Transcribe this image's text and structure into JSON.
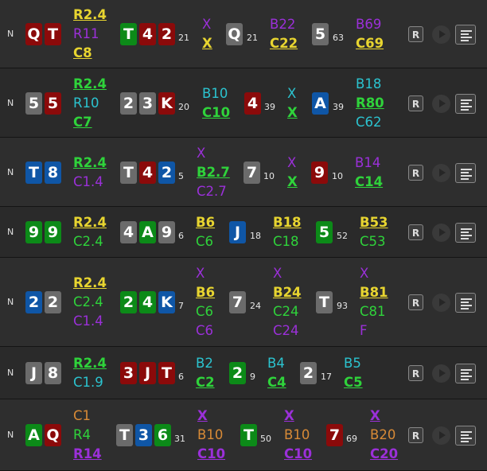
{
  "rows": [
    {
      "position": "N",
      "hand": [
        {
          "rank": "Q",
          "color": "red"
        },
        {
          "rank": "T",
          "color": "red"
        }
      ],
      "preflop_actions": [
        {
          "text": "R2.4",
          "color": "yellow",
          "strong": true
        },
        {
          "text": "R11",
          "color": "purple",
          "strong": false
        },
        {
          "text": "C8",
          "color": "yellow",
          "strong": true
        }
      ],
      "flop": {
        "cards": [
          {
            "rank": "T",
            "color": "green"
          },
          {
            "rank": "4",
            "color": "red"
          },
          {
            "rank": "2",
            "color": "red"
          }
        ],
        "pot": "21"
      },
      "flop_actions": [
        {
          "text": "X",
          "color": "purple",
          "strong": false
        },
        {
          "text": "X",
          "color": "yellow",
          "strong": true
        }
      ],
      "turn": {
        "card": {
          "rank": "Q",
          "color": "grey"
        },
        "pot": "21"
      },
      "turn_actions": [
        {
          "text": "B22",
          "color": "purple",
          "strong": false
        },
        {
          "text": "C22",
          "color": "yellow",
          "strong": true
        }
      ],
      "river": {
        "card": {
          "rank": "5",
          "color": "grey"
        },
        "pot": "63"
      },
      "river_actions": [
        {
          "text": "B69",
          "color": "purple",
          "strong": false
        },
        {
          "text": "C69",
          "color": "yellow",
          "strong": true
        }
      ],
      "replay_label": "R"
    },
    {
      "position": "N",
      "hand": [
        {
          "rank": "5",
          "color": "grey"
        },
        {
          "rank": "5",
          "color": "red"
        }
      ],
      "preflop_actions": [
        {
          "text": "R2.4",
          "color": "green",
          "strong": true
        },
        {
          "text": "R10",
          "color": "cyan",
          "strong": false
        },
        {
          "text": "C7",
          "color": "green",
          "strong": true
        }
      ],
      "flop": {
        "cards": [
          {
            "rank": "2",
            "color": "grey"
          },
          {
            "rank": "3",
            "color": "grey"
          },
          {
            "rank": "K",
            "color": "red"
          }
        ],
        "pot": "20"
      },
      "flop_actions": [
        {
          "text": "B10",
          "color": "cyan",
          "strong": false
        },
        {
          "text": "C10",
          "color": "green",
          "strong": true
        }
      ],
      "turn": {
        "card": {
          "rank": "4",
          "color": "red"
        },
        "pot": "39"
      },
      "turn_actions": [
        {
          "text": "X",
          "color": "cyan",
          "strong": false
        },
        {
          "text": "X",
          "color": "green",
          "strong": true
        }
      ],
      "river": {
        "card": {
          "rank": "A",
          "color": "blue"
        },
        "pot": "39"
      },
      "river_actions": [
        {
          "text": "B18",
          "color": "cyan",
          "strong": false
        },
        {
          "text": "R80",
          "color": "green",
          "strong": true
        },
        {
          "text": "C62",
          "color": "cyan",
          "strong": false
        }
      ],
      "replay_label": "R"
    },
    {
      "position": "N",
      "hand": [
        {
          "rank": "T",
          "color": "blue"
        },
        {
          "rank": "8",
          "color": "blue"
        }
      ],
      "preflop_actions": [
        {
          "text": "R2.4",
          "color": "green",
          "strong": true
        },
        {
          "text": "C1.4",
          "color": "purple",
          "strong": false
        }
      ],
      "flop": {
        "cards": [
          {
            "rank": "T",
            "color": "grey"
          },
          {
            "rank": "4",
            "color": "red"
          },
          {
            "rank": "2",
            "color": "blue"
          }
        ],
        "pot": "5"
      },
      "flop_actions": [
        {
          "text": "X",
          "color": "purple",
          "strong": false
        },
        {
          "text": "B2.7",
          "color": "green",
          "strong": true
        },
        {
          "text": "C2.7",
          "color": "purple",
          "strong": false
        }
      ],
      "turn": {
        "card": {
          "rank": "7",
          "color": "grey"
        },
        "pot": "10"
      },
      "turn_actions": [
        {
          "text": "X",
          "color": "purple",
          "strong": false
        },
        {
          "text": "X",
          "color": "green",
          "strong": true
        }
      ],
      "river": {
        "card": {
          "rank": "9",
          "color": "red"
        },
        "pot": "10"
      },
      "river_actions": [
        {
          "text": "B14",
          "color": "purple",
          "strong": false
        },
        {
          "text": "C14",
          "color": "green",
          "strong": true
        }
      ],
      "replay_label": "R"
    },
    {
      "position": "N",
      "hand": [
        {
          "rank": "9",
          "color": "green"
        },
        {
          "rank": "9",
          "color": "green"
        }
      ],
      "preflop_actions": [
        {
          "text": "R2.4",
          "color": "yellow",
          "strong": true
        },
        {
          "text": "C2.4",
          "color": "green",
          "strong": false
        }
      ],
      "flop": {
        "cards": [
          {
            "rank": "4",
            "color": "grey"
          },
          {
            "rank": "A",
            "color": "green"
          },
          {
            "rank": "9",
            "color": "grey"
          }
        ],
        "pot": "6"
      },
      "flop_actions": [
        {
          "text": "B6",
          "color": "yellow",
          "strong": true
        },
        {
          "text": "C6",
          "color": "green",
          "strong": false
        }
      ],
      "turn": {
        "card": {
          "rank": "J",
          "color": "blue"
        },
        "pot": "18"
      },
      "turn_actions": [
        {
          "text": "B18",
          "color": "yellow",
          "strong": true
        },
        {
          "text": "C18",
          "color": "green",
          "strong": false
        }
      ],
      "river": {
        "card": {
          "rank": "5",
          "color": "green"
        },
        "pot": "52"
      },
      "river_actions": [
        {
          "text": "B53",
          "color": "yellow",
          "strong": true
        },
        {
          "text": "C53",
          "color": "green",
          "strong": false
        }
      ],
      "replay_label": "R"
    },
    {
      "position": "N",
      "hand": [
        {
          "rank": "2",
          "color": "blue"
        },
        {
          "rank": "2",
          "color": "grey"
        }
      ],
      "preflop_actions": [
        {
          "text": "R2.4",
          "color": "yellow",
          "strong": true
        },
        {
          "text": "C2.4",
          "color": "green",
          "strong": false
        },
        {
          "text": "C1.4",
          "color": "purple",
          "strong": false
        }
      ],
      "flop": {
        "cards": [
          {
            "rank": "2",
            "color": "green"
          },
          {
            "rank": "4",
            "color": "green"
          },
          {
            "rank": "K",
            "color": "blue"
          }
        ],
        "pot": "7"
      },
      "flop_actions": [
        {
          "text": "X",
          "color": "purple",
          "strong": false
        },
        {
          "text": "B6",
          "color": "yellow",
          "strong": true
        },
        {
          "text": "C6",
          "color": "green",
          "strong": false
        },
        {
          "text": "C6",
          "color": "purple",
          "strong": false
        }
      ],
      "turn": {
        "card": {
          "rank": "7",
          "color": "grey"
        },
        "pot": "24"
      },
      "turn_actions": [
        {
          "text": "X",
          "color": "purple",
          "strong": false
        },
        {
          "text": "B24",
          "color": "yellow",
          "strong": true
        },
        {
          "text": "C24",
          "color": "green",
          "strong": false
        },
        {
          "text": "C24",
          "color": "purple",
          "strong": false
        }
      ],
      "river": {
        "card": {
          "rank": "T",
          "color": "grey"
        },
        "pot": "93"
      },
      "river_actions": [
        {
          "text": "X",
          "color": "purple",
          "strong": false
        },
        {
          "text": "B81",
          "color": "yellow",
          "strong": true
        },
        {
          "text": "C81",
          "color": "green",
          "strong": false
        },
        {
          "text": "F",
          "color": "purple",
          "strong": false
        }
      ],
      "replay_label": "R"
    },
    {
      "position": "N",
      "hand": [
        {
          "rank": "J",
          "color": "grey"
        },
        {
          "rank": "8",
          "color": "grey"
        }
      ],
      "preflop_actions": [
        {
          "text": "R2.4",
          "color": "green",
          "strong": true
        },
        {
          "text": "C1.9",
          "color": "cyan",
          "strong": false
        }
      ],
      "flop": {
        "cards": [
          {
            "rank": "3",
            "color": "red"
          },
          {
            "rank": "J",
            "color": "red"
          },
          {
            "rank": "T",
            "color": "red"
          }
        ],
        "pot": "6"
      },
      "flop_actions": [
        {
          "text": "B2",
          "color": "cyan",
          "strong": false
        },
        {
          "text": "C2",
          "color": "green",
          "strong": true
        }
      ],
      "turn": {
        "card": {
          "rank": "2",
          "color": "green"
        },
        "pot": "9"
      },
      "turn_actions": [
        {
          "text": "B4",
          "color": "cyan",
          "strong": false
        },
        {
          "text": "C4",
          "color": "green",
          "strong": true
        }
      ],
      "river": {
        "card": {
          "rank": "2",
          "color": "grey"
        },
        "pot": "17"
      },
      "river_actions": [
        {
          "text": "B5",
          "color": "cyan",
          "strong": false
        },
        {
          "text": "C5",
          "color": "green",
          "strong": true
        }
      ],
      "replay_label": "R"
    },
    {
      "position": "N",
      "hand": [
        {
          "rank": "A",
          "color": "green"
        },
        {
          "rank": "Q",
          "color": "red"
        }
      ],
      "preflop_actions": [
        {
          "text": "C1",
          "color": "orange",
          "strong": false
        },
        {
          "text": "R4",
          "color": "green",
          "strong": false
        },
        {
          "text": "R14",
          "color": "purple",
          "strong": true
        }
      ],
      "flop": {
        "cards": [
          {
            "rank": "T",
            "color": "grey"
          },
          {
            "rank": "3",
            "color": "blue"
          },
          {
            "rank": "6",
            "color": "green"
          }
        ],
        "pot": "31"
      },
      "flop_actions": [
        {
          "text": "X",
          "color": "purple",
          "strong": true
        },
        {
          "text": "B10",
          "color": "orange",
          "strong": false
        },
        {
          "text": "C10",
          "color": "purple",
          "strong": true
        }
      ],
      "turn": {
        "card": {
          "rank": "T",
          "color": "green"
        },
        "pot": "50"
      },
      "turn_actions": [
        {
          "text": "X",
          "color": "purple",
          "strong": true
        },
        {
          "text": "B10",
          "color": "orange",
          "strong": false
        },
        {
          "text": "C10",
          "color": "purple",
          "strong": true
        }
      ],
      "river": {
        "card": {
          "rank": "7",
          "color": "red"
        },
        "pot": "69"
      },
      "river_actions": [
        {
          "text": "X",
          "color": "purple",
          "strong": true
        },
        {
          "text": "B20",
          "color": "orange",
          "strong": false
        },
        {
          "text": "C20",
          "color": "purple",
          "strong": true
        }
      ],
      "replay_label": "R"
    }
  ]
}
